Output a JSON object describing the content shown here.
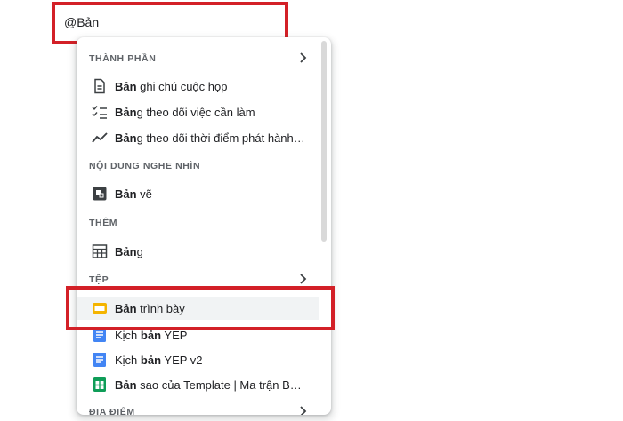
{
  "query": "@Bản",
  "sections": {
    "components": "THÀNH PHẦN",
    "visual": "NỘI DUNG NGHE NHÌN",
    "more": "THÊM",
    "files": "TỆP",
    "places": "ĐỊA ĐIỂM"
  },
  "items": {
    "meeting_notes": {
      "bold": "Bản",
      "rest": " ghi chú cuộc họp",
      "icon": "document-icon"
    },
    "task_tracker": {
      "bold": "Bản",
      "rest": "g theo dõi việc cần làm",
      "icon": "checklist-icon"
    },
    "launch_tracker": {
      "bold": "Bản",
      "rest": "g theo dõi thời điểm phát hành…",
      "icon": "trending-icon"
    },
    "drawing": {
      "bold": "Bản",
      "rest": " vẽ",
      "icon": "drawing-icon"
    },
    "table": {
      "bold": "Bản",
      "rest": "g",
      "icon": "table-icon"
    },
    "presentation": {
      "bold": "Bản",
      "rest": " trình bày",
      "icon": "slides-icon"
    },
    "script_yep": {
      "pre": "Kịch ",
      "bold": "bản",
      "rest": " YEP",
      "icon": "docs-icon"
    },
    "script_yep_v2": {
      "pre": "Kịch ",
      "bold": "bản",
      "rest": " YEP v2",
      "icon": "docs-icon"
    },
    "template_copy": {
      "bold": "Bản",
      "rest": " sao của Template | Ma trận B…",
      "icon": "sheets-icon"
    }
  },
  "colors": {
    "highlight_border": "#d32027",
    "slides": "#f4b400",
    "docs": "#4285f4",
    "sheets": "#0f9d58"
  }
}
